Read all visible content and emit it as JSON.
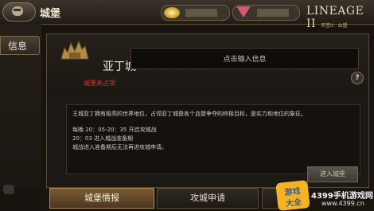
{
  "header": {
    "title": "城堡",
    "gold_icon": "gold-coin-icon",
    "gem_icon": "ruby-gem-icon"
  },
  "logo": {
    "text": "LINEAGE II",
    "subtitle": "天堂II：血盟"
  },
  "sidebar": {
    "tab_label": "信息"
  },
  "castle": {
    "name": "亚丁城",
    "status": "城堡未占领",
    "notice_placeholder": "点击输入信息",
    "help_symbol": "?"
  },
  "description": {
    "main": "王城亚丁拥有极高的世界地位，占领亚丁城是各个血盟争夺的终极目标，是实力和地位的象征。",
    "line1": "每晚 20：05-20：35 开启攻城战",
    "line2": "20：03 进入城战准备期",
    "line3": "城战进入准备期后无法再进攻城申请。"
  },
  "buttons": {
    "enter_castle": "进入城堡"
  },
  "tabs": {
    "info": "城堡情报",
    "apply": "攻城申请"
  },
  "watermark": {
    "badge_top": "游戏",
    "badge_bottom": "大全",
    "site": "4399手机游戏网",
    "url": "www.4399.cn"
  },
  "colors": {
    "accent": "#ae8a4d",
    "status_red": "#d73a2c"
  }
}
